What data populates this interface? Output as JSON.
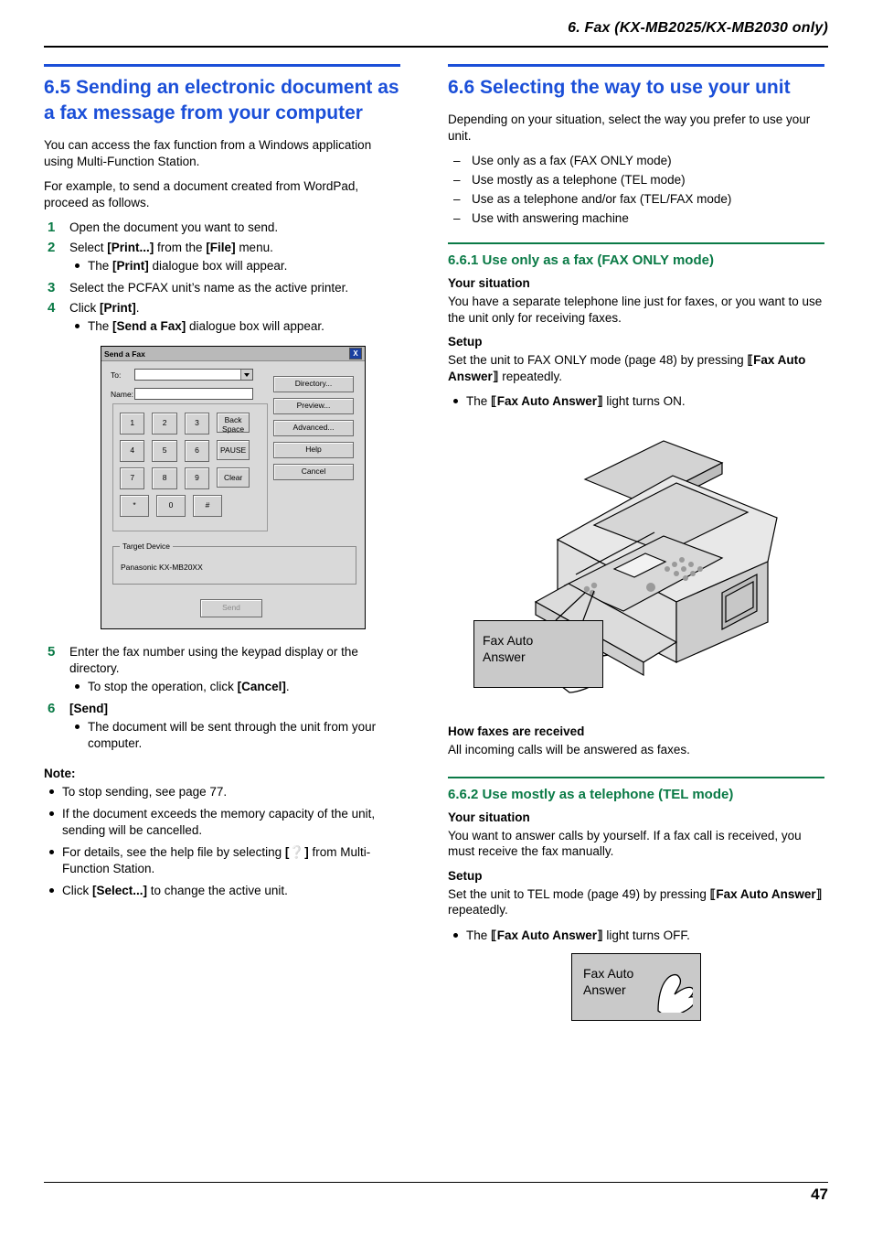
{
  "header": {
    "title": "6. Fax (KX-MB2025/KX-MB2030 only)",
    "page_number": "47"
  },
  "left": {
    "section_title": "6.5 Sending an electronic document as a fax message from your computer",
    "intro1": "You can access the fax function from a Windows application using Multi-Function Station.",
    "intro2": "For example, to send a document created from WordPad, proceed as follows.",
    "steps": [
      {
        "num": "1",
        "text": "Open the document you want to send.",
        "bullets": []
      },
      {
        "num": "2",
        "text": "Select [Print...] from the [File] menu.",
        "bullets": [
          "The [Print] dialogue box will appear."
        ]
      },
      {
        "num": "3",
        "text": "Select the PCFAX unit’s name as the active printer.",
        "bullets": []
      },
      {
        "num": "4",
        "text": "Click [Print].",
        "bullets": [
          "The [Send a Fax] dialogue box will appear."
        ]
      }
    ],
    "steps2": [
      {
        "num": "5",
        "text": "Enter the fax number using the keypad display or the directory.",
        "bullets": [
          "To stop the operation, click [Cancel]."
        ]
      },
      {
        "num": "6",
        "text": "[Send]",
        "bullets": [
          "The document will be sent through the unit from your computer."
        ]
      }
    ],
    "note_label": "Note:",
    "notes": [
      "To stop sending, see page 77.",
      "If the document exceeds the memory capacity of the unit, sending will be cancelled.",
      "For details, see the help file by selecting [ ? ] from Multi-Function Station.",
      "Click [Select...] to change the active unit."
    ],
    "dialog": {
      "title": "Send a Fax",
      "close_label": "X",
      "to_label": "To:",
      "to_value": "",
      "name_label": "Name:",
      "name_value": "",
      "buttons": [
        "Directory...",
        "Preview...",
        "Advanced...",
        "Help",
        "Cancel"
      ],
      "keys_row1": [
        "1",
        "2",
        "3"
      ],
      "keys_row1_wide": "Back Space",
      "keys_row2": [
        "4",
        "5",
        "6"
      ],
      "keys_row2_wide": "PAUSE",
      "keys_row3": [
        "7",
        "8",
        "9"
      ],
      "keys_row3_wide": "Clear",
      "keys_row4": [
        "*",
        "0",
        "#"
      ],
      "target_legend": "Target Device",
      "target_value": "Panasonic KX-MB20XX",
      "send_label": "Send"
    }
  },
  "right": {
    "section_title": "6.6 Selecting the way to use your unit",
    "intro": "Depending on your situation, select the way you prefer to use your unit.",
    "options": [
      "Use only as a fax (FAX ONLY mode)",
      "Use mostly as a telephone (TEL mode)",
      "Use as a telephone and/or fax (TEL/FAX mode)",
      "Use with answering machine"
    ],
    "sub1": {
      "title": "6.6.1 Use only as a fax (FAX ONLY mode)",
      "situation_label": "Your situation",
      "situation_text": "You have a separate telephone line just for faxes, or you want to use the unit only for receiving faxes.",
      "setup_label": "Setup",
      "setup_text": "Set the unit to FAX ONLY mode (page 48) by pressing {Fax Auto Answer} repeatedly.",
      "bullet": "The {Fax Auto Answer} light turns ON.",
      "callout_line1": "Fax Auto",
      "callout_line2": "Answer",
      "how_label": "How faxes are received",
      "how_text": "All incoming calls will be answered as faxes."
    },
    "sub2": {
      "title": "6.6.2 Use mostly as a telephone (TEL mode)",
      "situation_label": "Your situation",
      "situation_text": "You want to answer calls by yourself. If a fax call is received, you must receive the fax manually.",
      "setup_label": "Setup",
      "setup_text": "Set the unit to TEL mode (page 49) by pressing {Fax Auto Answer} repeatedly.",
      "bullet": "The {Fax Auto Answer} light turns OFF.",
      "callout_line1": "Fax Auto",
      "callout_line2": "Answer"
    }
  }
}
